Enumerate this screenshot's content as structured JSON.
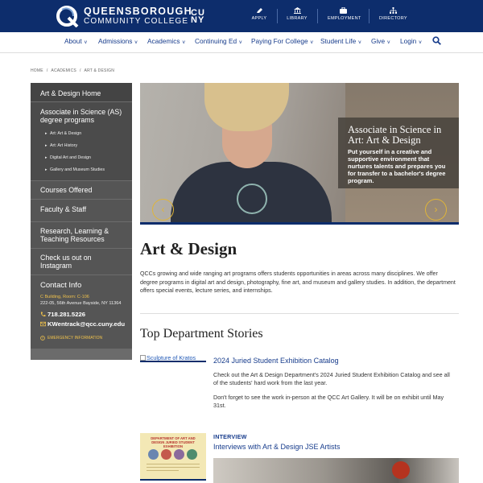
{
  "header": {
    "logo_line1": "QUEENSBOROUGH",
    "logo_line2": "COMMUNITY COLLEGE",
    "cuny_line1": "CU",
    "cuny_line2": "NY",
    "quick_links": [
      {
        "label": "APPLY",
        "icon": "pencil-icon"
      },
      {
        "label": "LIBRARY",
        "icon": "library-icon"
      },
      {
        "label": "EMPLOYMENT",
        "icon": "briefcase-icon"
      },
      {
        "label": "DIRECTORY",
        "icon": "directory-icon"
      }
    ],
    "colors": {
      "navy": "#0d2d6c",
      "gold": "#e0b538",
      "link": "#173c8c"
    }
  },
  "nav": {
    "items": [
      "About",
      "Admissions",
      "Academics",
      "Continuing Ed",
      "Paying For College",
      "Student Life",
      "Give",
      "Login"
    ],
    "search_icon": "search-icon"
  },
  "breadcrumb": [
    "HOME",
    "/",
    "ACADEMICS",
    "/",
    "ART & DESIGN"
  ],
  "sidebar": {
    "home": "Art & Design Home",
    "as_programs": "Associate in Science (AS) degree programs",
    "sub_items": [
      "Art: Art & Design",
      "Art: Art History",
      "Digital Art and Design",
      "Gallery and Museum Studies"
    ],
    "courses": "Courses Offered",
    "faculty": "Faculty & Staff",
    "research": "Research, Learning & Teaching Resources",
    "instagram": "Check us out on Instagram",
    "contact": {
      "heading": "Contact Info",
      "building": "C Building, Room: C-106",
      "address": "222-05, 56th Avenue Bayside, NY 11364",
      "phone": "718.281.5226",
      "email": "KWentrack@qcc.cuny.edu",
      "emergency": "EMERGENCY INFORMATION"
    }
  },
  "hero": {
    "title": "Associate in Science in Art: Art & Design",
    "desc": "Put yourself in a creative and supportive environment that nurtures talents and prepares you for transfer to a bachelor's degree program.",
    "prev": "‹",
    "next": "›"
  },
  "main": {
    "title": "Art & Design",
    "intro": "QCCs growing and wide ranging art programs offers students opportunities in areas across many disciplines. We offer degree programs in digital art and design, photography, fine art, and museum and gallery studies. In addition, the department offers special events, lecture series, and internships.",
    "stories_heading": "Top Department Stories",
    "story1": {
      "img_alt": "Sculpture of Kratos",
      "title": "2024 Juried Student Exhibition Catalog",
      "p1": "Check out the Art & Design Department's 2024 Juried Student Exhibition Catalog and see all of the students' hard work from the last year.",
      "p2": "Don't forget to see the work in-person at the QCC Art Gallery.  It will be on exhibit until May 31st."
    },
    "story2": {
      "tag": "INTERVIEW",
      "title": "Interviews with Art & Design JSE Artists",
      "img_text": "DEPARTMENT OF ART AND DESIGN JURIED STUDENT EXHIBITION"
    }
  }
}
